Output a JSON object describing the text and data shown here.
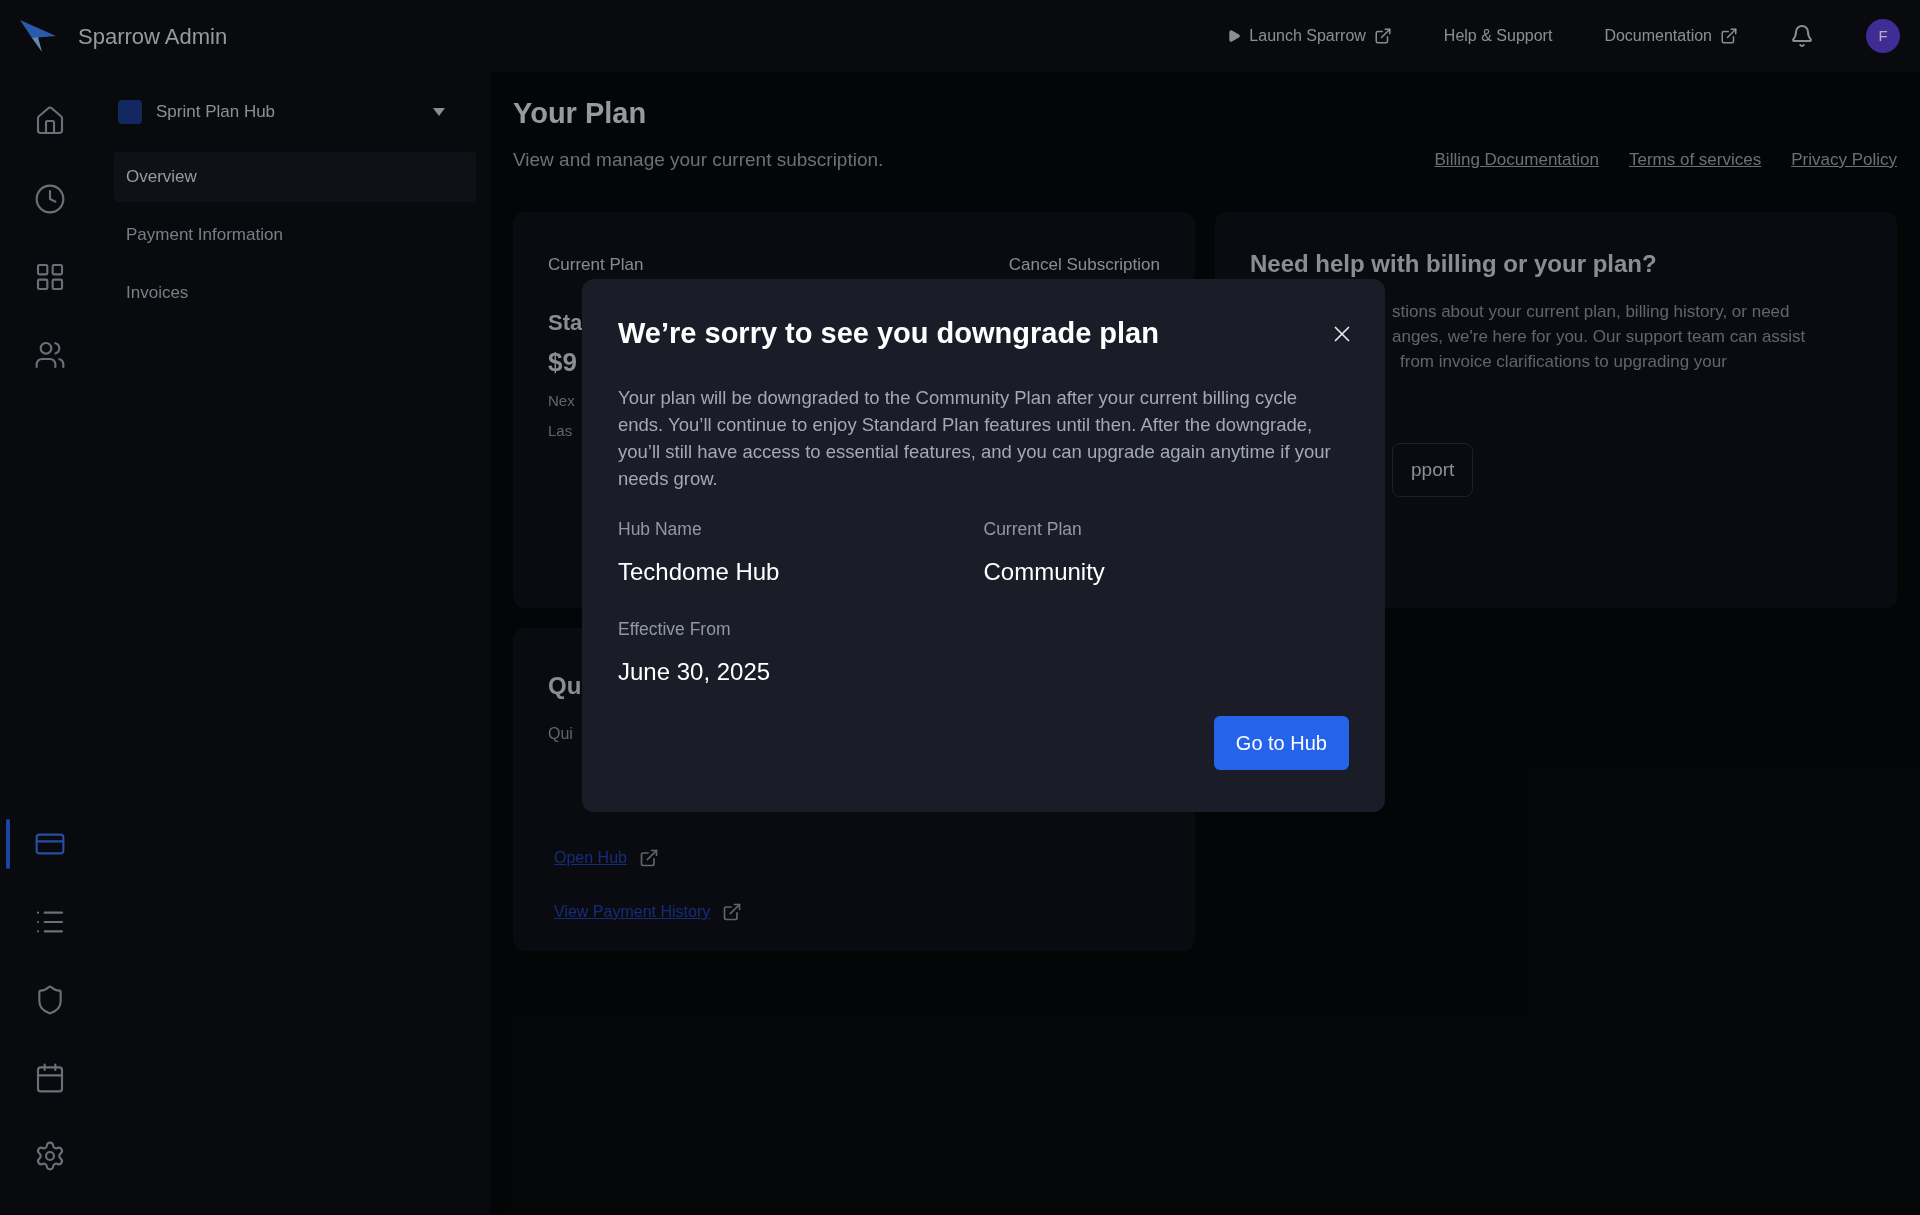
{
  "topbar": {
    "app_name": "Sparrow Admin",
    "links": [
      {
        "label": "Launch Sparrow",
        "kind": "launch"
      },
      {
        "label": "Help & Support",
        "kind": "plain"
      },
      {
        "label": "Documentation",
        "kind": "external"
      }
    ],
    "avatar_initial": "F"
  },
  "rail": {
    "top_items": [
      {
        "selected": false
      },
      {
        "selected": false
      },
      {
        "selected": false
      },
      {
        "selected": false
      }
    ],
    "bottom_items": [
      {
        "selected": true
      },
      {
        "selected": false
      },
      {
        "selected": false
      },
      {
        "selected": false
      },
      {
        "selected": false
      }
    ]
  },
  "hub_selector": {
    "name": "Sprint Plan Hub"
  },
  "nav": [
    {
      "label": "Overview",
      "selected": true
    },
    {
      "label": "Payment Information",
      "selected": false
    },
    {
      "label": "Invoices",
      "selected": false
    }
  ],
  "page": {
    "title": "Your Plan",
    "subtitle": "View and manage your current subscription.",
    "links": [
      "Billing Documentation",
      "Terms of services",
      "Privacy Policy"
    ]
  },
  "plan_card": {
    "label": "Current Plan",
    "action": "Cancel Subscription",
    "name_fragment": "Sta",
    "price_fragment": "$9",
    "line_fragments": [
      "Nex",
      "Las"
    ]
  },
  "help_card": {
    "title": "Need help with billing or your plan?",
    "text_fragments": [
      "stions about your current plan, billing history, or need",
      "anges, we're here for you. Our support team can assist",
      "from invoice clarifications to upgrading your"
    ],
    "button_fragment": "pport"
  },
  "quick_links_card": {
    "title_fragment": "Qu",
    "subtitle_fragment": "Qui",
    "links": [
      "Open Hub",
      "View Payment History"
    ]
  },
  "modal": {
    "title": "We’re sorry to see you downgrade plan",
    "body": "Your plan will be downgraded to the Community Plan after your current billing cycle ends. You’ll continue to enjoy Standard Plan features until then. After the downgrade, you’ll still have access to essential features, and you can upgrade again anytime if your needs grow.",
    "fields": [
      {
        "label": "Hub Name",
        "value": "Techdome Hub"
      },
      {
        "label": "Current Plan",
        "value": "Community"
      },
      {
        "label": "Effective From",
        "value": "June 30, 2025"
      }
    ],
    "button": "Go to Hub"
  }
}
